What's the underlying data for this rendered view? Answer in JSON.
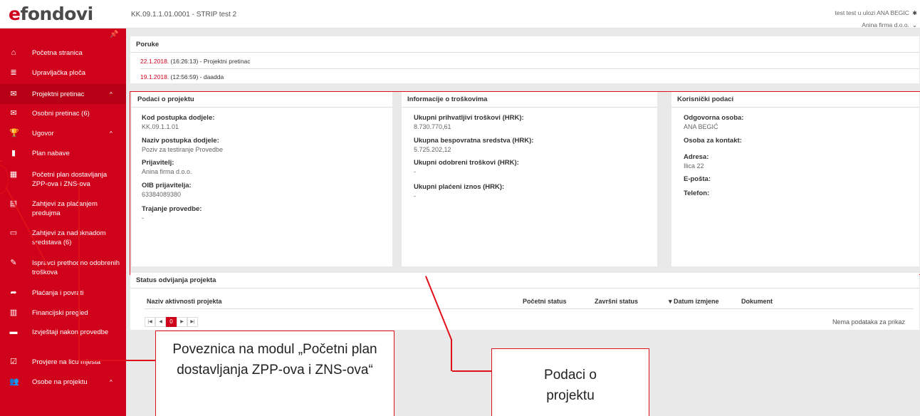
{
  "header": {
    "logo_e": "e",
    "logo_rest": "fondovi",
    "project_code": "KK.09.1.1.01.0001 - STRIP test 2",
    "user_line1": "test test u ulozi ANA BEGIC",
    "user_line2": "Anina firma d.o.o."
  },
  "sidebar": {
    "items": [
      {
        "label": "Početna stranica",
        "icon": "home-icon"
      },
      {
        "label": "Upravljačka ploča",
        "icon": "list-icon"
      },
      {
        "label": "Projektni pretinac",
        "icon": "envelope-icon",
        "caret": "^"
      },
      {
        "label": "Osobni pretinac (6)",
        "icon": "envelope-icon"
      },
      {
        "label": "Ugovor",
        "icon": "trophy-icon",
        "caret": "^"
      },
      {
        "label": "Plan nabave",
        "icon": "bookmark-icon"
      },
      {
        "label": "Početni plan dostavljanja ZPP-ova i ZNS-ova",
        "icon": "calendar-icon"
      },
      {
        "label": "Zahtjevi za plaćanjem predujma",
        "icon": "document-icon"
      },
      {
        "label": "Zahtjevi za nadoknadom sredstava (6)",
        "icon": "credit-card-icon"
      },
      {
        "label": "Ispravci prethodno odobrenih troškova",
        "icon": "edit-icon"
      },
      {
        "label": "Plaćanja i povrati",
        "icon": "share-icon"
      },
      {
        "label": "Financijski pregled",
        "icon": "bar-chart-icon"
      },
      {
        "label": "Izvještaji nakon provedbe",
        "icon": "report-icon"
      },
      {
        "label": "Provjere na licu mjesta",
        "icon": "checkbox-icon"
      },
      {
        "label": "Osobe na projektu",
        "icon": "users-icon",
        "caret": "^"
      }
    ]
  },
  "poruke": {
    "title": "Poruke",
    "messages": [
      {
        "date": "22.1.2018.",
        "rest": " (16:26:13) - Projektni pretinac"
      },
      {
        "date": "19.1.2018.",
        "rest": " (12:56:59) - daadda"
      }
    ]
  },
  "podaci": {
    "title": "Podaci o projektu",
    "fields": [
      {
        "label": "Kod postupka dodjele:",
        "value": "KK.09.1.1.01"
      },
      {
        "label": "Naziv postupka dodjele:",
        "value": "Poziv za testiranje Provedbe"
      },
      {
        "label": "Prijavitelj:",
        "value": "Anina firma d.o.o."
      },
      {
        "label": "OIB prijavitelja:",
        "value": "63384089380"
      },
      {
        "label": "Trajanje provedbe:",
        "value": "-"
      }
    ]
  },
  "troskovi": {
    "title": "Informacije o troškovima",
    "fields": [
      {
        "label": "Ukupni prihvatljivi troškovi (HRK):",
        "value": "8.730.770,61"
      },
      {
        "label": "Ukupna bespovratna sredstva (HRK):",
        "value": "5.725.202,12"
      },
      {
        "label": "Ukupni odobreni troškovi (HRK):",
        "value": "-"
      },
      {
        "label": "Ukupni plaćeni iznos (HRK):",
        "value": "-"
      }
    ]
  },
  "korisnicki": {
    "title": "Korisnički podaci",
    "fields": [
      {
        "label": "Odgovorna osoba:",
        "value": "ANA BEGIĆ"
      },
      {
        "label": "Osoba za kontakt:",
        "value": ""
      },
      {
        "label": "Adresa:",
        "value": "Ilica 22"
      },
      {
        "label": "E-pošta:",
        "value": ""
      },
      {
        "label": "Telefon:",
        "value": ""
      }
    ]
  },
  "status": {
    "title": "Status odvijanja projekta",
    "columns": [
      "Naziv aktivnosti projekta",
      "Početni status",
      "Završni status",
      "▾ Datum izmjene",
      "Dokument"
    ],
    "pager": {
      "current": "0"
    },
    "no_data": "Nema podataka za prikaz"
  },
  "callouts": {
    "left": "Poveznica na modul „Početni plan dostavljanja ZPP-ova i ZNS-ova“",
    "right": "Podaci o projektu"
  },
  "colors": {
    "accent": "#d0021b",
    "annotation": "#e0101a"
  }
}
